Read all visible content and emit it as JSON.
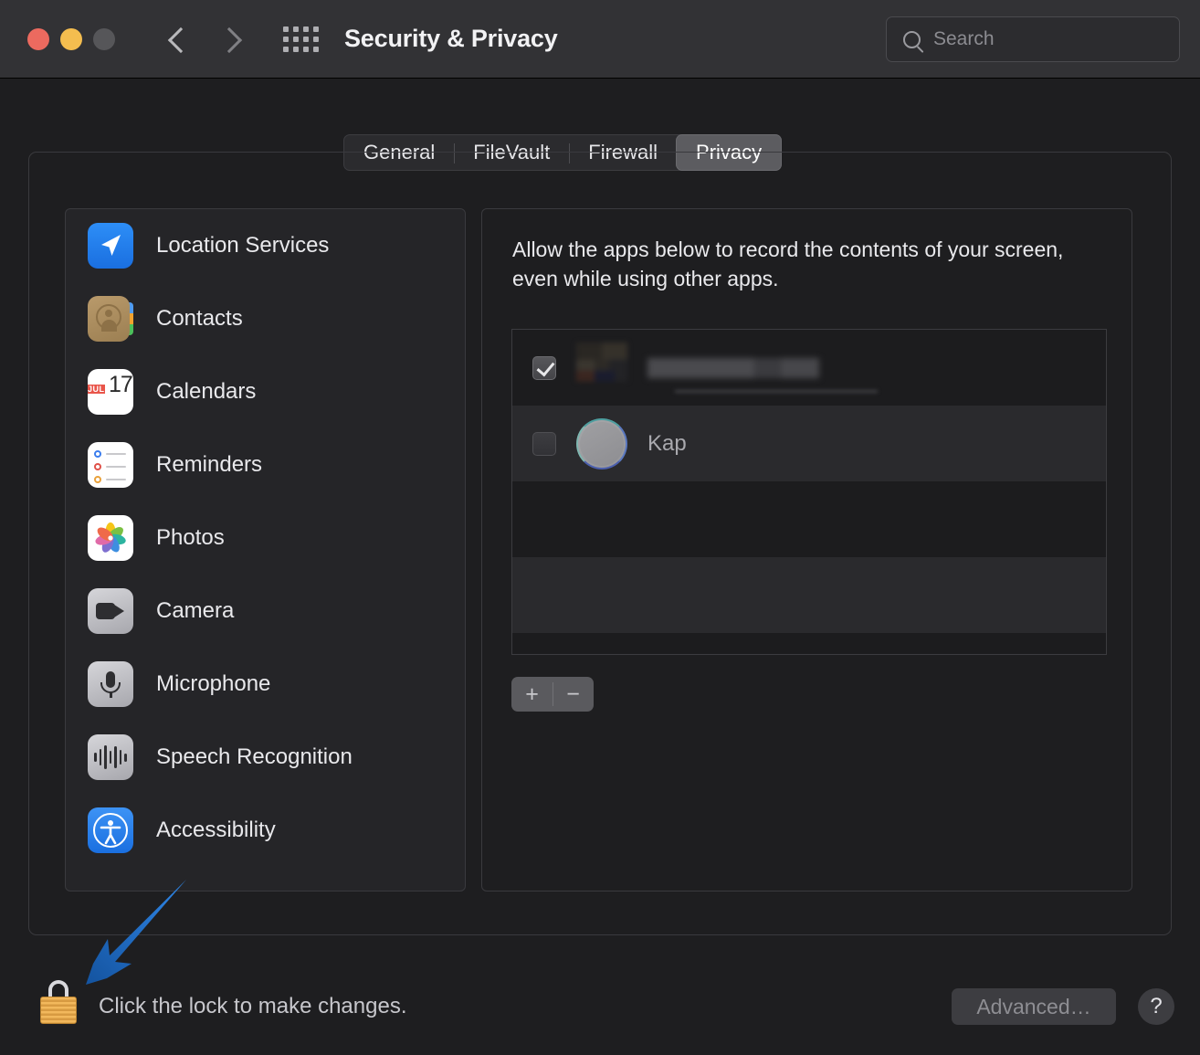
{
  "window": {
    "title": "Security & Privacy",
    "traffic_lights": [
      "close-red",
      "minimize-yellow",
      "zoom-gray"
    ],
    "back_label": "Back",
    "forward_label": "Forward",
    "grid_label": "Show All"
  },
  "search": {
    "placeholder": "Search",
    "value": "",
    "icon": "search-icon"
  },
  "tabs": [
    {
      "label": "General",
      "active": false
    },
    {
      "label": "FileVault",
      "active": false
    },
    {
      "label": "Firewall",
      "active": false
    },
    {
      "label": "Privacy",
      "active": true
    }
  ],
  "sidebar": {
    "items": [
      {
        "label": "Location Services",
        "icon": "location-services-icon"
      },
      {
        "label": "Contacts",
        "icon": "contacts-icon"
      },
      {
        "label": "Calendars",
        "icon": "calendars-icon"
      },
      {
        "label": "Reminders",
        "icon": "reminders-icon"
      },
      {
        "label": "Photos",
        "icon": "photos-icon"
      },
      {
        "label": "Camera",
        "icon": "camera-icon"
      },
      {
        "label": "Microphone",
        "icon": "microphone-icon"
      },
      {
        "label": "Speech Recognition",
        "icon": "speech-recognition-icon"
      },
      {
        "label": "Accessibility",
        "icon": "accessibility-icon"
      }
    ]
  },
  "calendar_icon": {
    "month": "JUL",
    "day": "17"
  },
  "main": {
    "description": "Allow the apps below to record the contents of your screen, even while using other apps.",
    "apps": [
      {
        "name": "",
        "redacted": true,
        "checked": true
      },
      {
        "name": "Kap",
        "redacted": false,
        "checked": false
      }
    ],
    "add_label": "+",
    "remove_label": "−"
  },
  "footer": {
    "lock_text": "Click the lock to make changes.",
    "lock_icon": "lock-closed-icon",
    "advanced_label": "Advanced…",
    "help_label": "?"
  },
  "annotation": {
    "arrow": "blue-arrow-pointing-to-lock",
    "color": "#1e70d8"
  }
}
